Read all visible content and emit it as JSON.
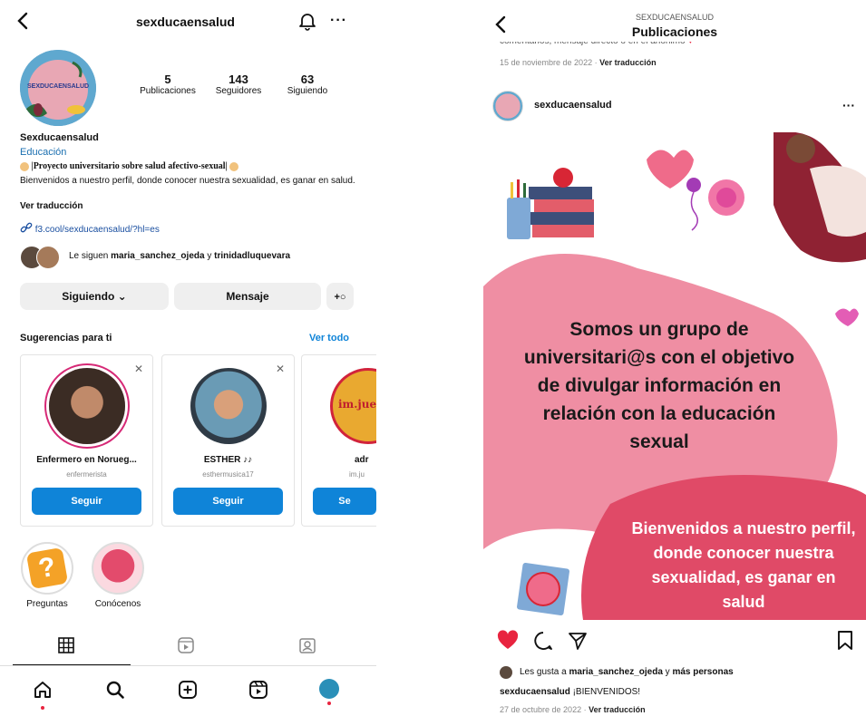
{
  "profile": {
    "username": "sexducaensalud",
    "avatar_text": "SEXDUCAENSALUD",
    "stats": [
      {
        "value": "5",
        "label": "Publicaciones"
      },
      {
        "value": "143",
        "label": "Seguidores"
      },
      {
        "value": "63",
        "label": "Siguiendo"
      }
    ],
    "name": "Sexducaensalud",
    "category": "Educación",
    "bio_line1": "|Proyecto universitario sobre salud afectivo-sexual|",
    "bio_line2": "Bienvenidos a nuestro perfil, donde conocer nuestra sexualidad, es ganar en salud.",
    "translate": "Ver traducción",
    "link": "f3.cool/sexducaensalud/?hl=es",
    "followed_by_prefix": "Le siguen",
    "followed_by_user1": "maria_sanchez_ojeda",
    "followed_by_and": "y",
    "followed_by_user2": "trinidadluquevara",
    "following_button": "Siguiendo",
    "message_button": "Mensaje"
  },
  "suggestions": {
    "title": "Sugerencias para ti",
    "see_all": "Ver todo",
    "cards": [
      {
        "name": "Enfermero en Norueg...",
        "username": "enfermerista",
        "button": "Seguir"
      },
      {
        "name": "ESTHER",
        "username": "esthermusica17",
        "button": "Seguir"
      },
      {
        "name": "adr",
        "username": "im.ju",
        "button": "Se",
        "avatar_text": "im.jue"
      }
    ]
  },
  "highlights": [
    {
      "label": "Preguntas"
    },
    {
      "label": "Conócenos"
    }
  ],
  "post": {
    "header_small": "SEXDUCAENSALUD",
    "header_title": "Publicaciones",
    "prev_date": "15 de noviembre de 2022",
    "prev_translate": "Ver traducción",
    "username": "sexducaensalud",
    "image_text_main": "Somos un grupo de universitari@s con el objetivo de divulgar información en relación con la educación sexual",
    "image_text_secondary": "Bienvenidos a nuestro perfil, donde conocer nuestra sexualidad, es ganar en salud",
    "likes_prefix": "Les gusta a",
    "likes_user": "maria_sanchez_ojeda",
    "likes_and": "y",
    "likes_more": "más personas",
    "caption_user": "sexducaensalud",
    "caption_text": "¡BIENVENIDOS!",
    "date": "27 de octubre de 2022",
    "translate": "Ver traducción"
  },
  "colors": {
    "accent_blue": "#0f84d8",
    "link_blue": "#1a5fb4",
    "pink": "#ef8ea3",
    "dark_pink": "#e04a67",
    "like_red": "#e8243f"
  }
}
